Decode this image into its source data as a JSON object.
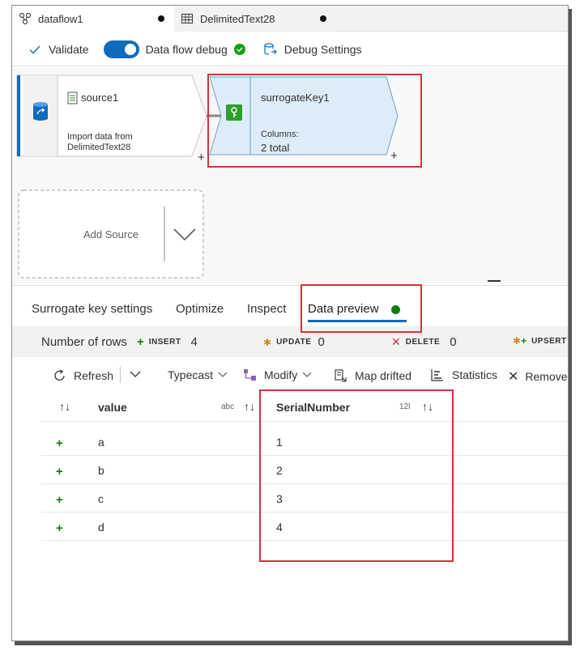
{
  "tabs": [
    {
      "label": "dataflow1",
      "modified": true
    },
    {
      "label": "DelimitedText28",
      "modified": true
    }
  ],
  "toolbar": {
    "validate": "Validate",
    "debug_label": "Data flow debug",
    "debug_settings": "Debug Settings"
  },
  "canvas": {
    "source": {
      "title": "source1",
      "desc_line1": "Import data from",
      "desc_line2": "DelimitedText28"
    },
    "surrogate": {
      "title": "surrogateKey1",
      "columns_label": "Columns:",
      "columns_value": "2 total"
    },
    "add_source": "Add Source",
    "plus": "+"
  },
  "panel": {
    "tabs": [
      "Surrogate key settings",
      "Optimize",
      "Inspect",
      "Data preview"
    ],
    "active_tab": "Data preview"
  },
  "rows_bar": {
    "number_label": "Number of rows",
    "insert_label": "INSERT",
    "insert_count": "4",
    "update_label": "UPDATE",
    "update_count": "0",
    "delete_label": "DELETE",
    "delete_count": "0",
    "upsert_label": "UPSERT"
  },
  "actions": {
    "refresh": "Refresh",
    "typecast": "Typecast",
    "modify": "Modify",
    "map_drifted": "Map drifted",
    "statistics": "Statistics",
    "remove": "Remove"
  },
  "grid": {
    "columns": [
      {
        "name": "value",
        "type": "abc"
      },
      {
        "name": "SerialNumber",
        "type": "12l"
      }
    ],
    "rows": [
      {
        "value": "a",
        "serial": "1"
      },
      {
        "value": "b",
        "serial": "2"
      },
      {
        "value": "c",
        "serial": "3"
      },
      {
        "value": "d",
        "serial": "4"
      }
    ]
  },
  "colors": {
    "accent": "#0f6cbd",
    "node_fill": "#deecf9",
    "highlight": "#d13438",
    "insert_green": "#107c10"
  }
}
